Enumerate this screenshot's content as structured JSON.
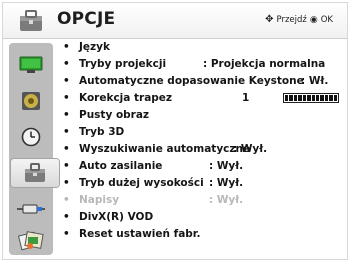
{
  "header": {
    "title": "OPCJE",
    "hint_move": "Przejdź",
    "hint_ok": "OK"
  },
  "sidebar": {
    "items": [
      {
        "icon": "picture-icon"
      },
      {
        "icon": "audio-icon"
      },
      {
        "icon": "time-icon"
      },
      {
        "icon": "option-icon",
        "active": true
      },
      {
        "icon": "input-icon"
      },
      {
        "icon": "media-icon"
      }
    ]
  },
  "menu": {
    "items": [
      {
        "label": "Język",
        "value": ""
      },
      {
        "label": "Tryby projekcji",
        "value": ": Projekcja normalna"
      },
      {
        "label": "Automatyczne dopasowanie Keystone",
        "value": ": Wł."
      },
      {
        "label": "Korekcja trapez",
        "value": "1",
        "bar_level": 1.0
      },
      {
        "label": "Pusty obraz",
        "value": ""
      },
      {
        "label": "Tryb 3D",
        "value": ""
      },
      {
        "label": "Wyszukiwanie automatyczne",
        "value": ": Wył."
      },
      {
        "label": "Auto zasilanie",
        "value": ": Wył."
      },
      {
        "label": "Tryb dużej wysokości",
        "value": ": Wył."
      },
      {
        "label": "Napisy",
        "value": ": Wył.",
        "disabled": true
      },
      {
        "label": "DivX(R) VOD",
        "value": ""
      },
      {
        "label": "Reset ustawień fabr.",
        "value": ""
      }
    ]
  }
}
